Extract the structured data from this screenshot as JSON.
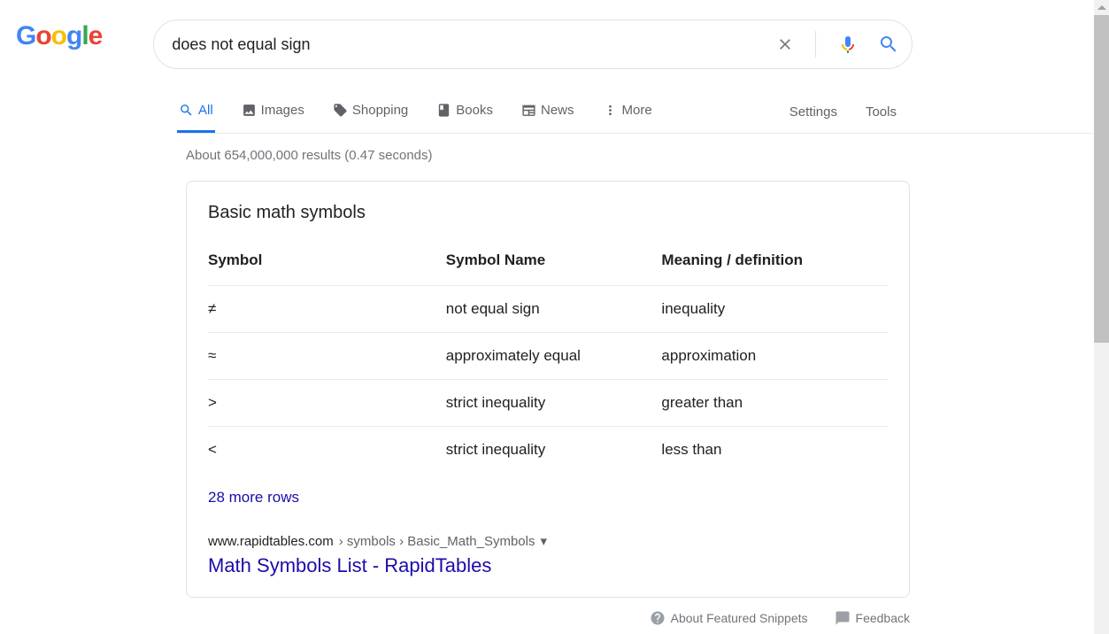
{
  "search": {
    "query": "does not equal sign"
  },
  "tabs": {
    "all": "All",
    "images": "Images",
    "shopping": "Shopping",
    "books": "Books",
    "news": "News",
    "more": "More",
    "settings": "Settings",
    "tools": "Tools"
  },
  "results": {
    "stats": "About 654,000,000 results (0.47 seconds)"
  },
  "snippet": {
    "heading": "Basic math symbols",
    "headers": {
      "symbol": "Symbol",
      "name": "Symbol Name",
      "meaning": "Meaning / definition"
    },
    "rows": [
      {
        "symbol": "≠",
        "name": "not equal sign",
        "meaning": "inequality"
      },
      {
        "symbol": "≈",
        "name": "approximately equal",
        "meaning": "approximation"
      },
      {
        "symbol": ">",
        "name": "strict inequality",
        "meaning": "greater than"
      },
      {
        "symbol": "<",
        "name": "strict inequality",
        "meaning": "less than"
      }
    ],
    "more_rows": "28 more rows",
    "cite_domain": "www.rapidtables.com",
    "cite_path": " › symbols › Basic_Math_Symbols",
    "link_title": "Math Symbols List - RapidTables"
  },
  "footer": {
    "about": "About Featured Snippets",
    "feedback": "Feedback"
  }
}
